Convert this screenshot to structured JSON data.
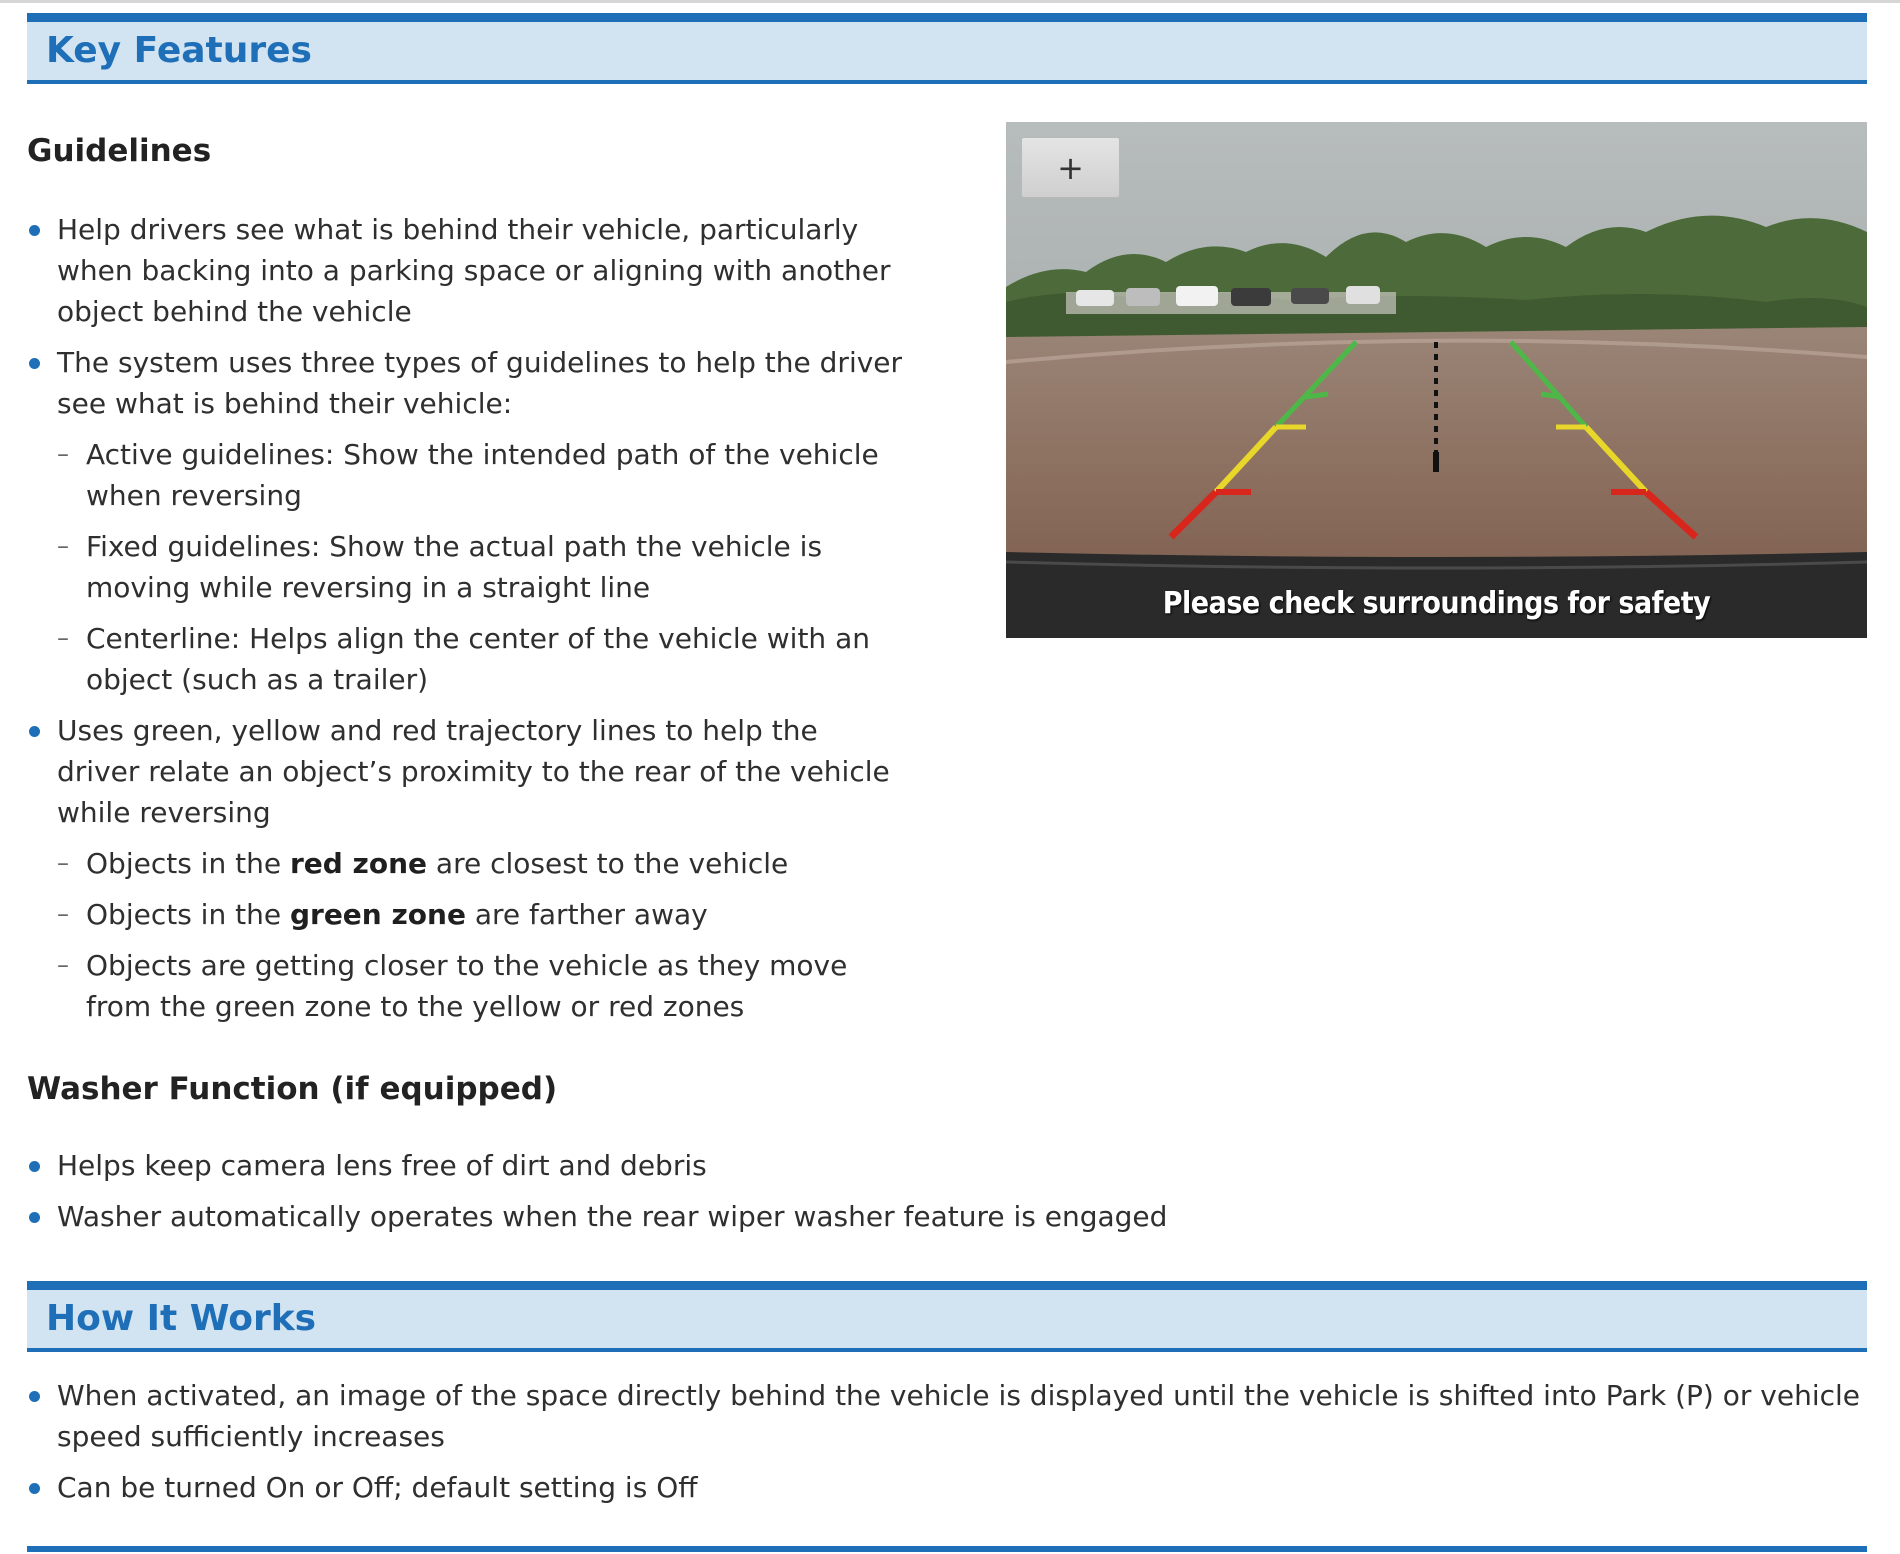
{
  "key_features": {
    "title": "Key Features",
    "guidelines": {
      "heading": "Guidelines",
      "bullets": [
        {
          "text": "Help drivers see what is behind their vehicle, particularly when backing into a parking space or aligning with another object behind the vehicle"
        },
        {
          "text": "The system uses three types of guidelines to help the driver see what is behind their vehicle:",
          "subs": [
            "Active guidelines: Show the intended path of the vehicle when reversing",
            "Fixed guidelines: Show the actual path the vehicle is moving while reversing in a straight line",
            "Centerline: Helps align the center of the vehicle with an object (such as a trailer)"
          ]
        },
        {
          "text": "Uses green, yellow and red trajectory lines to help the driver relate an object’s proximity to the rear of the vehicle while reversing",
          "subs_rich": [
            {
              "before": "Objects in the ",
              "bold": "red zone",
              "after": " are closest to the vehicle"
            },
            {
              "before": "Objects in the ",
              "bold": "green zone",
              "after": " are farther away"
            },
            {
              "before": "Objects are getting closer to the vehicle as they move from the green zone to the yellow or red zones",
              "bold": "",
              "after": ""
            }
          ]
        }
      ]
    },
    "washer": {
      "heading": "Washer Function (if equipped)",
      "bullets": [
        "Helps keep camera lens free of dirt and debris",
        "Washer automatically operates when the rear wiper washer feature is engaged"
      ]
    },
    "image": {
      "zoom_label": "+",
      "caption": "Please check surroundings for safety",
      "colors": {
        "green": "#4db848",
        "yellow": "#e8d62a",
        "red": "#d8261c"
      }
    }
  },
  "how_it_works": {
    "title": "How It Works",
    "bullets": [
      "When activated, an image of the space directly behind the vehicle is displayed until the vehicle is shifted into Park (P) or vehicle speed sufficiently increases",
      "Can be turned On or Off; default setting is Off"
    ]
  },
  "accent_color": "#1e6fb7"
}
